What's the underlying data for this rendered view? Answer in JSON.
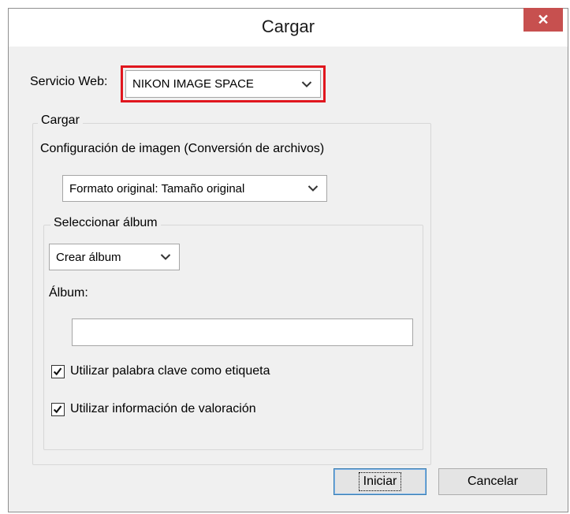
{
  "dialog": {
    "title": "Cargar",
    "close_glyph": "✕"
  },
  "service": {
    "label": "Servicio Web:",
    "selected": "NIKON IMAGE SPACE"
  },
  "upload_group": {
    "legend": "Cargar",
    "image_settings_label": "Configuración de imagen (Conversión de archivos)",
    "format_selected": "Formato original: Tamaño original"
  },
  "album_group": {
    "legend": "Seleccionar álbum",
    "album_mode_selected": "Crear álbum",
    "album_label": "Álbum:",
    "album_name_value": ""
  },
  "options": {
    "use_keyword_label": "Utilizar palabra clave como etiqueta",
    "use_keyword_checked": true,
    "use_rating_label": "Utilizar información de valoración",
    "use_rating_checked": true
  },
  "buttons": {
    "start": "Iniciar",
    "cancel": "Cancelar"
  },
  "colors": {
    "highlight": "#e0161e",
    "close_button": "#c7504f"
  },
  "icons": {
    "dropdown": "chevron-down-icon",
    "checkbox": "checkmark-icon",
    "close": "close-icon"
  }
}
